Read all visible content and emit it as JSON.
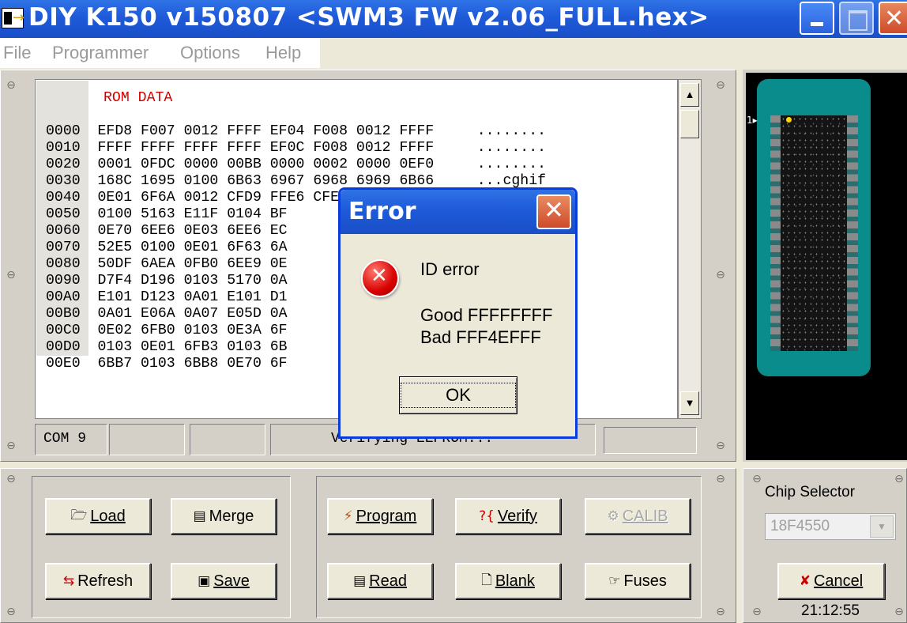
{
  "window": {
    "title": "DIY K150 v150807  <SWM3 FW v2.06_FULL.hex>"
  },
  "menu": [
    "File",
    "Programmer",
    "Options",
    "Help"
  ],
  "rom": {
    "label": "ROM DATA",
    "lines": [
      "0000  EFD8 F007 0012 FFFF EF04 F008 0012 FFFF     ........",
      "0010  FFFF FFFF FFFF FFFF EF0C F008 0012 FFFF     ........",
      "0020  0001 0FDC 0000 00BB 0000 0002 0000 0EF0     ........",
      "0030  168C 1695 0100 6B63 6967 6968 6969 6B66     ...cghif",
      "0040  0E01 6F6A 0012 CFD9 FFE6 CFE1 FFD9 52E6     .j......",
      "0050  0100 5163 E11F 0104 BF                      c....@.",
      "0060  0E70 6EE6 0E03 6EE6 EC                      ........",
      "0070  52E5 0100 0E01 6F63 6A                      ..c.@..",
      "0080  50DF 6AEA 0FB0 6EE9 0E                      ........",
      "0090  D7F4 D196 0103 5170 0A                      ..p.....",
      "00A0  E101 D123 0A01 E101 D1                      #.......",
      "00B0  0A01 E06A 0A07 E05D 0A                      ].l.....",
      "00C0  0E02 6FB0 0103 0E3A 6F                      ..:.....",
      "00D0  0103 0E01 6FB3 0103 6B                      ........",
      "00E0  6BB7 0103 6BB8 0E70 6F                      ...p...."
    ]
  },
  "status": {
    "port": "COM 9",
    "message": "Verifying EEPROM..."
  },
  "chip_preview": {
    "pin1_label": "1"
  },
  "buttons": {
    "load": "Load",
    "merge": "Merge",
    "refresh": "Refresh",
    "save": "Save",
    "program": "Program",
    "verify": "Verify",
    "calib": "CALIB",
    "read": "Read",
    "blank": "Blank",
    "fuses": "Fuses",
    "cancel": "Cancel"
  },
  "chip_selector": {
    "title": "Chip Selector",
    "value": "18F4550"
  },
  "clock": "21:12:55",
  "dialog": {
    "title": "Error",
    "line1": "ID error",
    "line2": "Good FFFFFFFF",
    "line3": "Bad FFF4EFFF",
    "ok": "OK"
  }
}
